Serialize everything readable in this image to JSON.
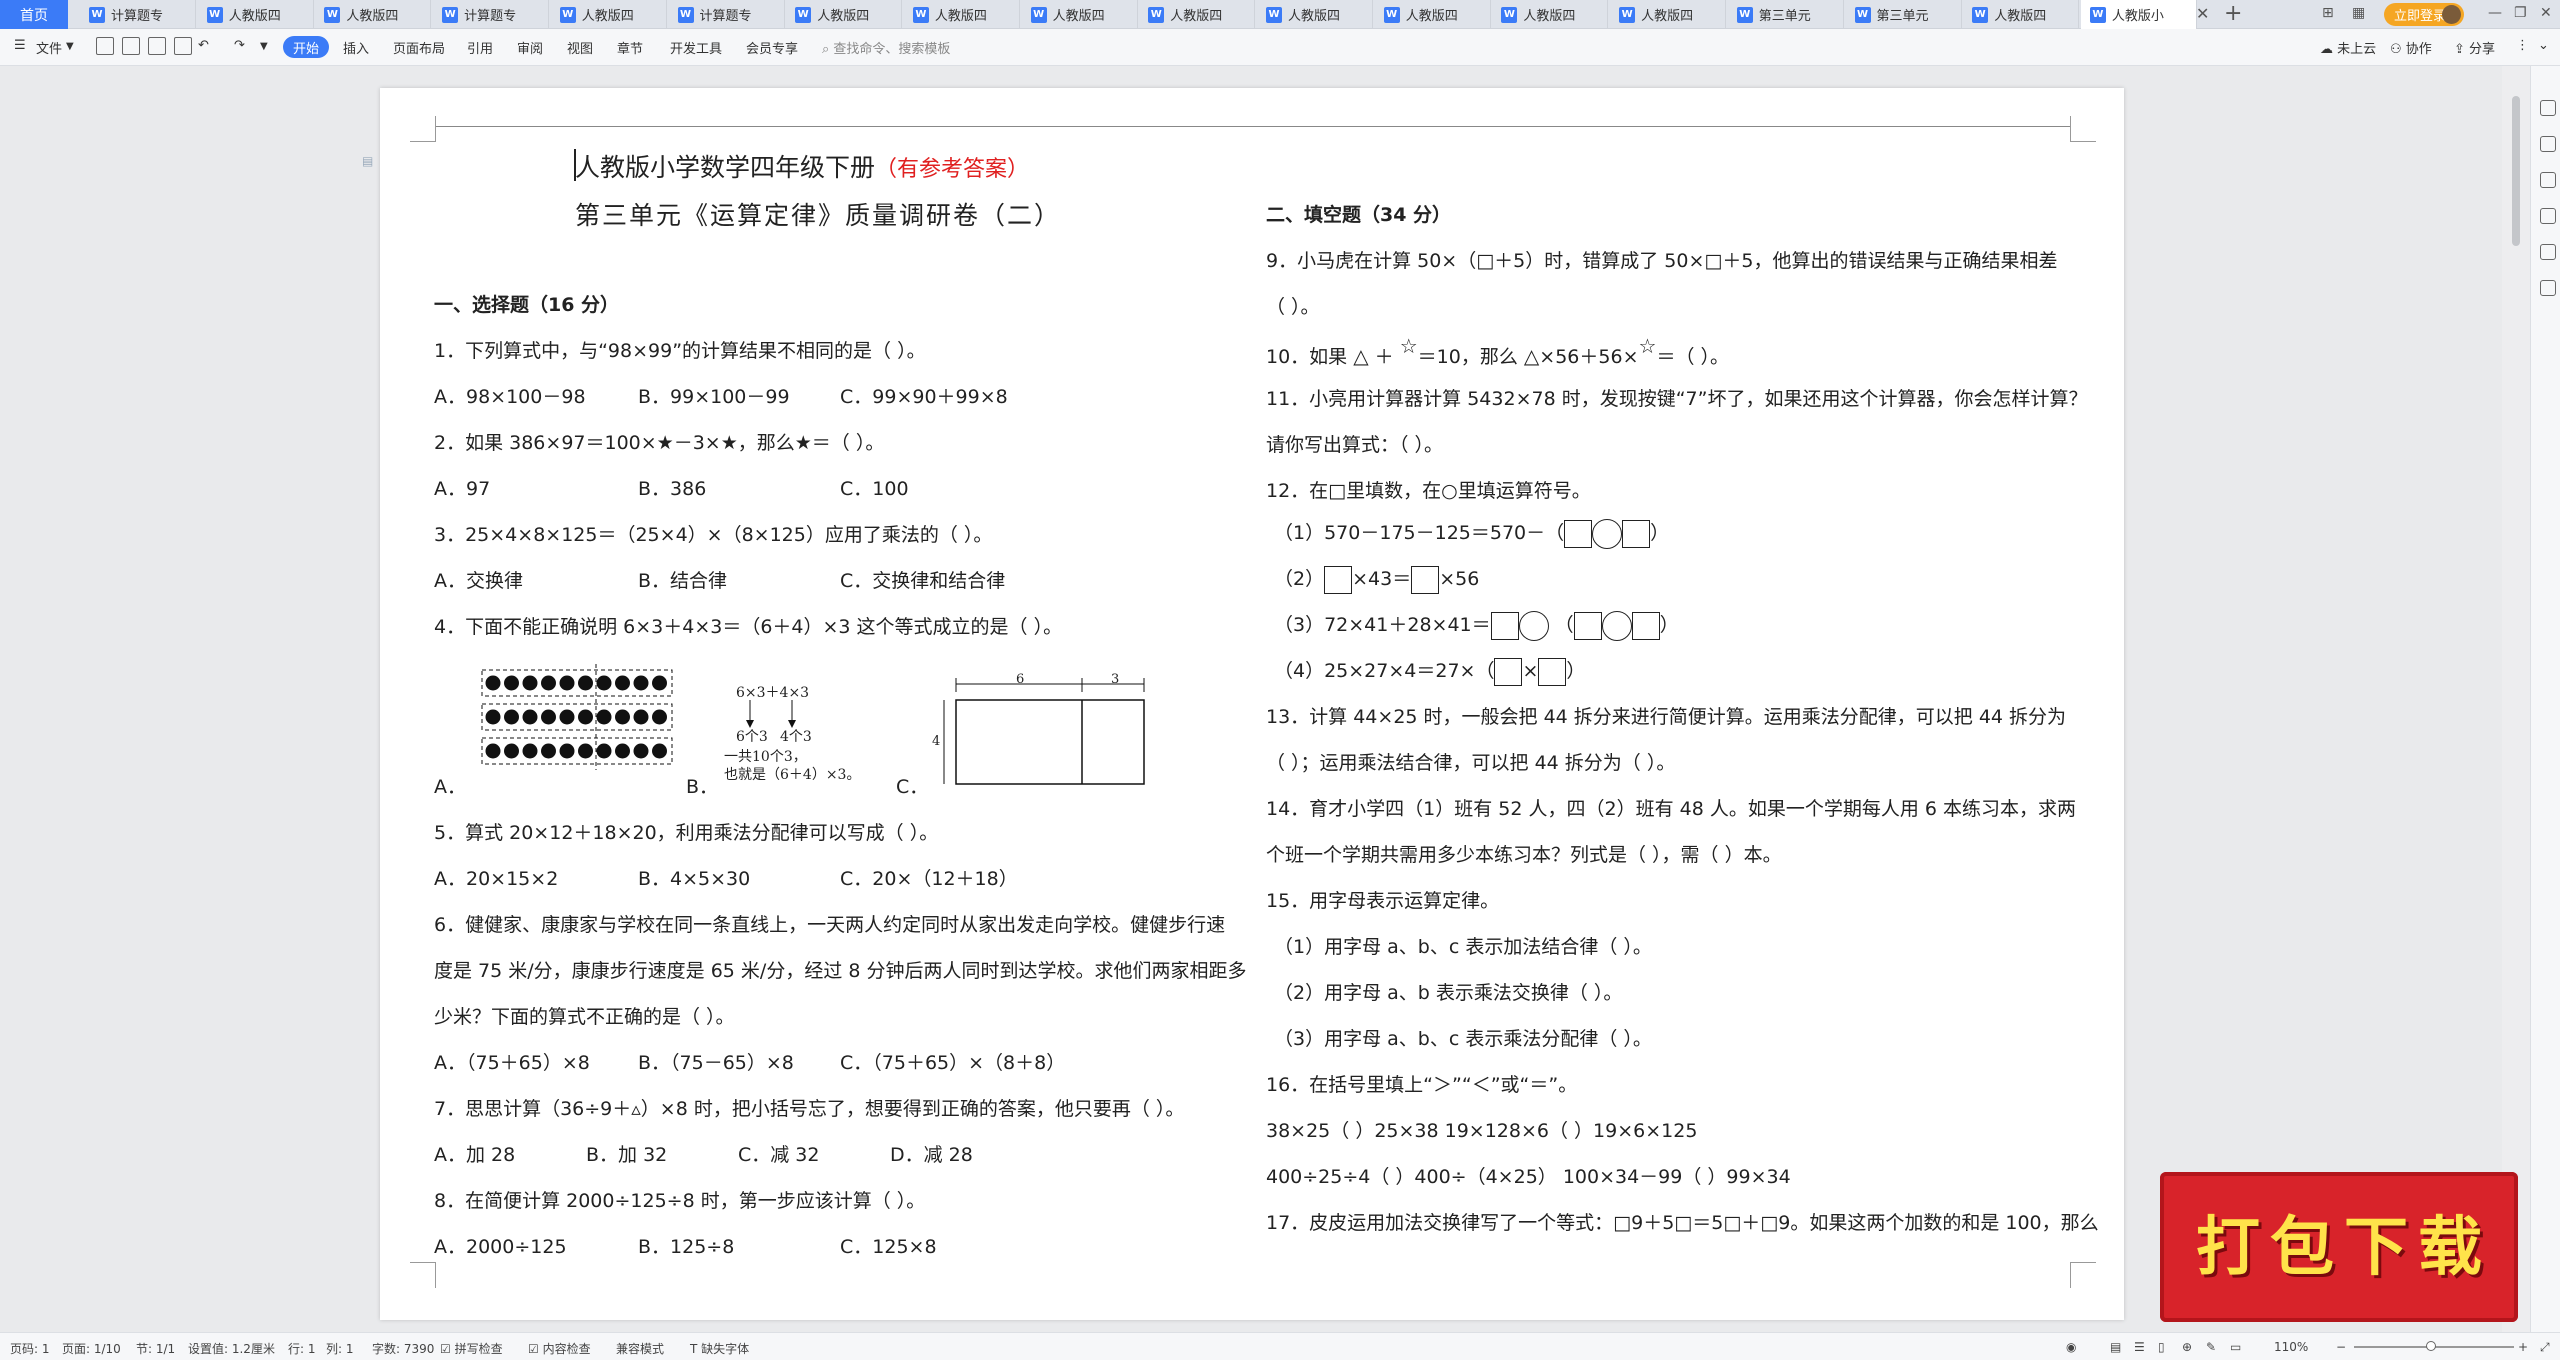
{
  "tabs": {
    "home": "首页",
    "items": [
      "计算题专",
      "人教版四",
      "人教版四",
      "计算题专",
      "人教版四",
      "计算题专",
      "人教版四",
      "人教版四",
      "人教版四",
      "人教版四",
      "人教版四",
      "人教版四",
      "人教版四",
      "人教版四",
      "第三单元",
      "第三单元",
      "人教版四",
      "人教版小"
    ],
    "login": "立即登录"
  },
  "toolbar": {
    "file": "文件",
    "start": "开始",
    "insert": "插入",
    "layout": "页面布局",
    "ref": "引用",
    "review": "审阅",
    "view": "视图",
    "chapter": "章节",
    "dev": "开发工具",
    "member": "会员专享",
    "search": "查找命令、搜索模板",
    "cloud": "未上云",
    "collab": "协作",
    "share": "分享"
  },
  "doc": {
    "title1": "人教版小学数学四年级下册",
    "title1_red": "（有参考答案）",
    "title2": "第三单元《运算定律》质量调研卷（二）",
    "s1": "一、选择题（16 分）",
    "q1": "1．下列算式中，与“98×99”的计算结果不相同的是（    ）。",
    "q1a": "A．98×100－98",
    "q1b": "B．99×100－99",
    "q1c": "C．99×90＋99×8",
    "q2": "2．如果 386×97＝100×★－3×★，那么★＝（    ）。",
    "q2a": "A．97",
    "q2b": "B．386",
    "q2c": "C．100",
    "q3": "3．25×4×8×125＝（25×4）×（8×125）应用了乘法的（    ）。",
    "q3a": "A．交换律",
    "q3b": "B．结合律",
    "q3c": "C．交换律和结合律",
    "q4": "4．下面不能正确说明 6×3＋4×3＝（6＋4）×3 这个等式成立的是（    ）。",
    "q4a": "A．",
    "q4b": "B．",
    "q4c": "C．",
    "q4b_l1": "6×3＋4×3",
    "q4b_l2": "6个3",
    "q4b_l3": "4个3",
    "q4b_l4": "一共10个3，",
    "q4b_l5": "也就是（6＋4）×3。",
    "q4c_6": "6",
    "q4c_3": "3",
    "q4c_4": "4",
    "q5": "5．算式 20×12＋18×20，利用乘法分配律可以写成（    ）。",
    "q5a": "A．20×15×2",
    "q5b": "B．4×5×30",
    "q5c": "C．20×（12＋18）",
    "q6_l1": "6．健健家、康康家与学校在同一条直线上，一天两人约定同时从家出发走向学校。健健步行速",
    "q6_l2": "度是 75 米/分，康康步行速度是 65 米/分，经过 8 分钟后两人同时到达学校。求他们两家相距多",
    "q6_l3": "少米？下面的算式不正确的是（    ）。",
    "q6a": "A．（75＋65）×8",
    "q6b": "B．（75－65）×8",
    "q6c": "C．（75＋65）×（8＋8）",
    "q7": "7．思思计算（36÷9＋▵）×8 时，把小括号忘了，想要得到正确的答案，他只要再（    ）。",
    "q7a": "A．加 28",
    "q7b": "B．加 32",
    "q7c": "C．减 32",
    "q7d": "D．减 28",
    "q8": "8．在简便计算 2000÷125÷8 时，第一步应该计算（    ）。",
    "q8a": "A．2000÷125",
    "q8b": "B．125÷8",
    "q8c": "C．125×8",
    "s2": "二、填空题（34 分）",
    "q9_l1": "9．小马虎在计算 50×（□＋5）时，错算成了 50×□＋5，他算出的错误结果与正确结果相差",
    "q9_l2": "（            ）。",
    "q10_a": "10．如果",
    "q10_b": "＋",
    "q10_c": "＝10，那么",
    "q10_d": "×56＋56×",
    "q10_e": "＝（            ）。",
    "q11_l1": "11．小亮用计算器计算 5432×78 时，发现按键“7”坏了，如果还用这个计算器，你会怎样计算？",
    "q11_l2": "请你写出算式：（            ）。",
    "q12": "12．在□里填数，在○里填运算符号。",
    "q12_1": "（1）570－175－125＝570－（",
    "q12_2a": "（2）",
    "q12_2b": "×43＝",
    "q12_2c": "×56",
    "q12_3": "（3）72×41＋28×41＝",
    "q12_4": "（4）25×27×4＝27×（",
    "q13_l1": "13．计算 44×25 时，一般会把 44 拆分来进行简便计算。运用乘法分配律，可以把 44 拆分为",
    "q13_l2": "（            ）；运用乘法结合律，可以把 44 拆分为（            ）。",
    "q14_l1": "14．育才小学四（1）班有 52 人，四（2）班有 48 人。如果一个学期每人用 6 本练习本，求两",
    "q14_l2": "个班一个学期共需用多少本练习本？列式是（                ），需（            ）本。",
    "q15": "15．用字母表示运算定律。",
    "q15_1": "（1）用字母 a、b、c 表示加法结合律（                        ）。",
    "q15_2": "（2）用字母 a、b 表示乘法交换律（                        ）。",
    "q15_3": "（3）用字母 a、b、c 表示乘法分配律（                        ）。",
    "q16": "16．在括号里填上“＞”“＜”或“＝”。",
    "q16_1": "38×25（            ）25×38     19×128×6（            ）19×6×125",
    "q16_2": "400÷25÷4（            ）400÷（4×25）     100×34－99（            ）99×34",
    "q17": "17．皮皮运用加法交换律写了一个等式：□9＋5□＝5□＋□9。如果这两个加数的和是 100，那么"
  },
  "banner": "打包下载",
  "status": {
    "pagenum": "页码: 1",
    "pages": "页面: 1/10",
    "section": "节: 1/1",
    "setting": "设置值: 1.2厘米",
    "row": "行: 1",
    "col": "列: 1",
    "words": "字数: 7390",
    "spell": "拼写检查",
    "content": "内容检查",
    "compat": "兼容模式",
    "font_missing": "缺失字体",
    "zoom": "110%"
  }
}
